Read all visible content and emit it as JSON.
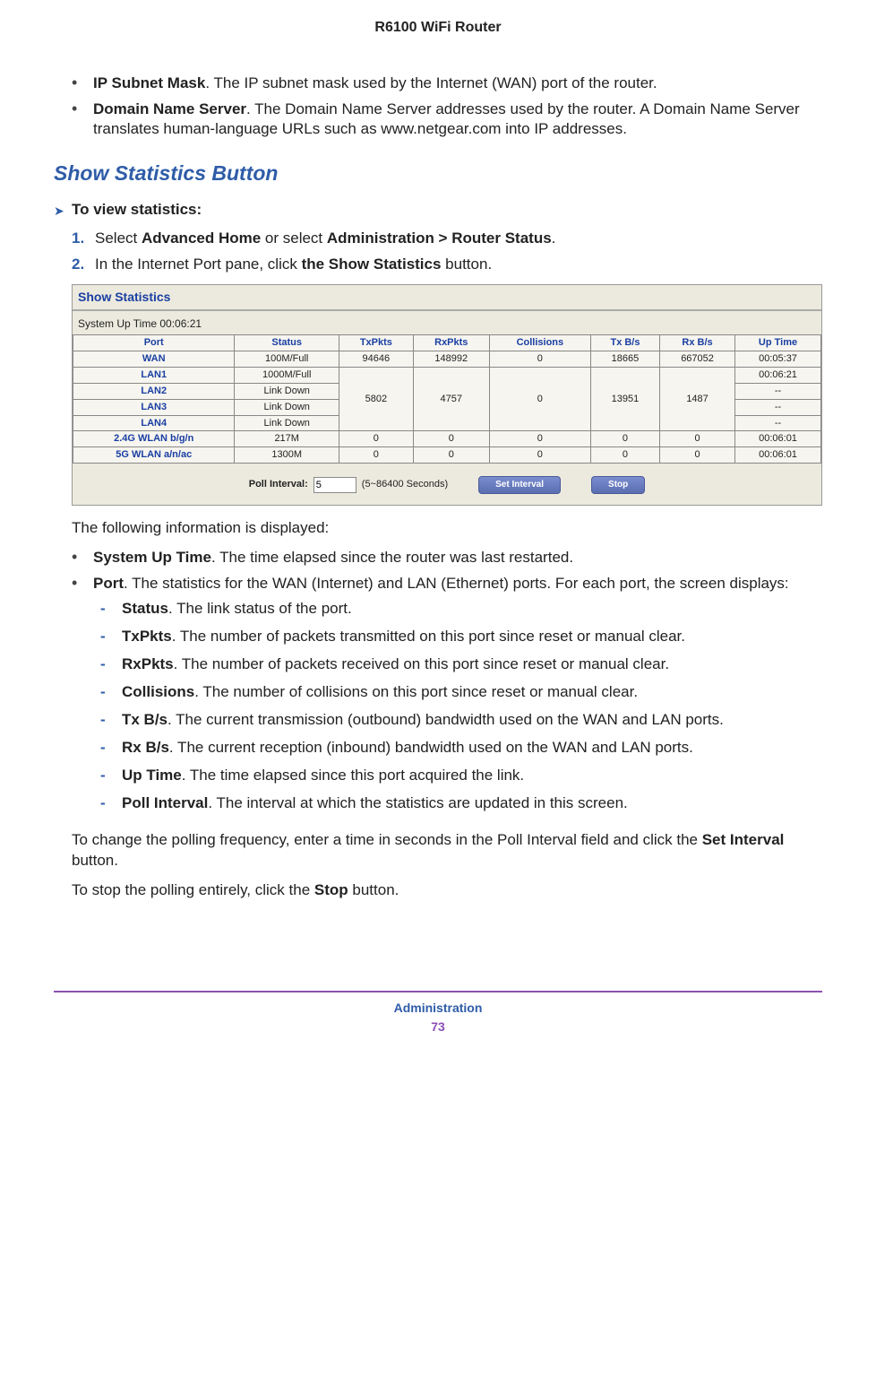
{
  "header": {
    "title": "R6100 WiFi Router"
  },
  "intro_bullets": [
    {
      "term": "IP Subnet Mask",
      "desc": ". The IP subnet mask used by the Internet (WAN) port of the router."
    },
    {
      "term": "Domain Name Server",
      "desc": ". The Domain Name Server addresses used by the router. A Domain Name Server translates human-language URLs such as www.netgear.com into IP addresses."
    }
  ],
  "section": {
    "heading": "Show Statistics Button",
    "proc_title": "To view statistics:"
  },
  "steps": [
    {
      "pre": "Select ",
      "b1": "Advanced Home",
      "mid": " or select ",
      "b2": "Administration > Router Status",
      "post": "."
    },
    {
      "pre": "In the Internet Port pane, click ",
      "b1": "the Show Statistics",
      "mid": " button.",
      "b2": "",
      "post": ""
    }
  ],
  "screenshot": {
    "title": "Show Statistics",
    "uptime_label": "System Up Time 00:06:21",
    "headers": [
      "Port",
      "Status",
      "TxPkts",
      "RxPkts",
      "Collisions",
      "Tx B/s",
      "Rx B/s",
      "Up Time"
    ],
    "rows": [
      {
        "port": "WAN",
        "status": "100M/Full",
        "tx": "94646",
        "rx": "148992",
        "col": "0",
        "txb": "18665",
        "rxb": "667052",
        "up": "00:05:37"
      },
      {
        "port": "LAN1",
        "status": "1000M/Full",
        "tx": "",
        "rx": "",
        "col": "",
        "txb": "",
        "rxb": "",
        "up": "00:06:21"
      },
      {
        "port": "LAN2",
        "status": "Link Down",
        "tx": "5802",
        "rx": "4757",
        "col": "0",
        "txb": "13951",
        "rxb": "1487",
        "up": "--"
      },
      {
        "port": "LAN3",
        "status": "Link Down",
        "tx": "",
        "rx": "",
        "col": "",
        "txb": "",
        "rxb": "",
        "up": "--"
      },
      {
        "port": "LAN4",
        "status": "Link Down",
        "tx": "",
        "rx": "",
        "col": "",
        "txb": "",
        "rxb": "",
        "up": "--"
      },
      {
        "port": "2.4G WLAN b/g/n",
        "status": "217M",
        "tx": "0",
        "rx": "0",
        "col": "0",
        "txb": "0",
        "rxb": "0",
        "up": "00:06:01"
      },
      {
        "port": "5G WLAN a/n/ac",
        "status": "1300M",
        "tx": "0",
        "rx": "0",
        "col": "0",
        "txb": "0",
        "rxb": "0",
        "up": "00:06:01"
      }
    ],
    "poll_label": "Poll Interval:",
    "poll_value": "5",
    "poll_hint": "(5~86400 Seconds)",
    "btn_set": "Set Interval",
    "btn_stop": "Stop"
  },
  "after_ss": "The following information is displayed:",
  "info_bullets": [
    {
      "term": "System Up Time",
      "desc": ". The time elapsed since the router was last restarted."
    },
    {
      "term": "Port",
      "desc": ". The statistics for the WAN (Internet) and LAN (Ethernet) ports. For each port, the screen displays:"
    }
  ],
  "sub_items": [
    {
      "term": "Status",
      "desc": ". The link status of the port."
    },
    {
      "term": "TxPkts",
      "desc": ". The number of packets transmitted on this port since reset or manual clear."
    },
    {
      "term": "RxPkts",
      "desc": ". The number of packets received on this port since reset or manual clear."
    },
    {
      "term": "Collisions",
      "desc": ". The number of collisions on this port since reset or manual clear."
    },
    {
      "term": "Tx B/s",
      "desc": ". The current transmission (outbound) bandwidth used on the WAN and LAN ports."
    },
    {
      "term": "Rx B/s",
      "desc": ". The current reception (inbound) bandwidth used on the WAN and LAN ports."
    },
    {
      "term": "Up Time",
      "desc": ". The time elapsed since this port acquired the link."
    },
    {
      "term": "Poll Interval",
      "desc": ". The interval at which the statistics are updated in this screen."
    }
  ],
  "para1": {
    "pre": "To change the polling frequency, enter a time in seconds in the Poll Interval field and click the ",
    "b": "Set Interval",
    "post": " button."
  },
  "para2": {
    "pre": "To stop the polling entirely, click the ",
    "b": "Stop",
    "post": " button."
  },
  "footer": {
    "section": "Administration",
    "page": "73"
  }
}
